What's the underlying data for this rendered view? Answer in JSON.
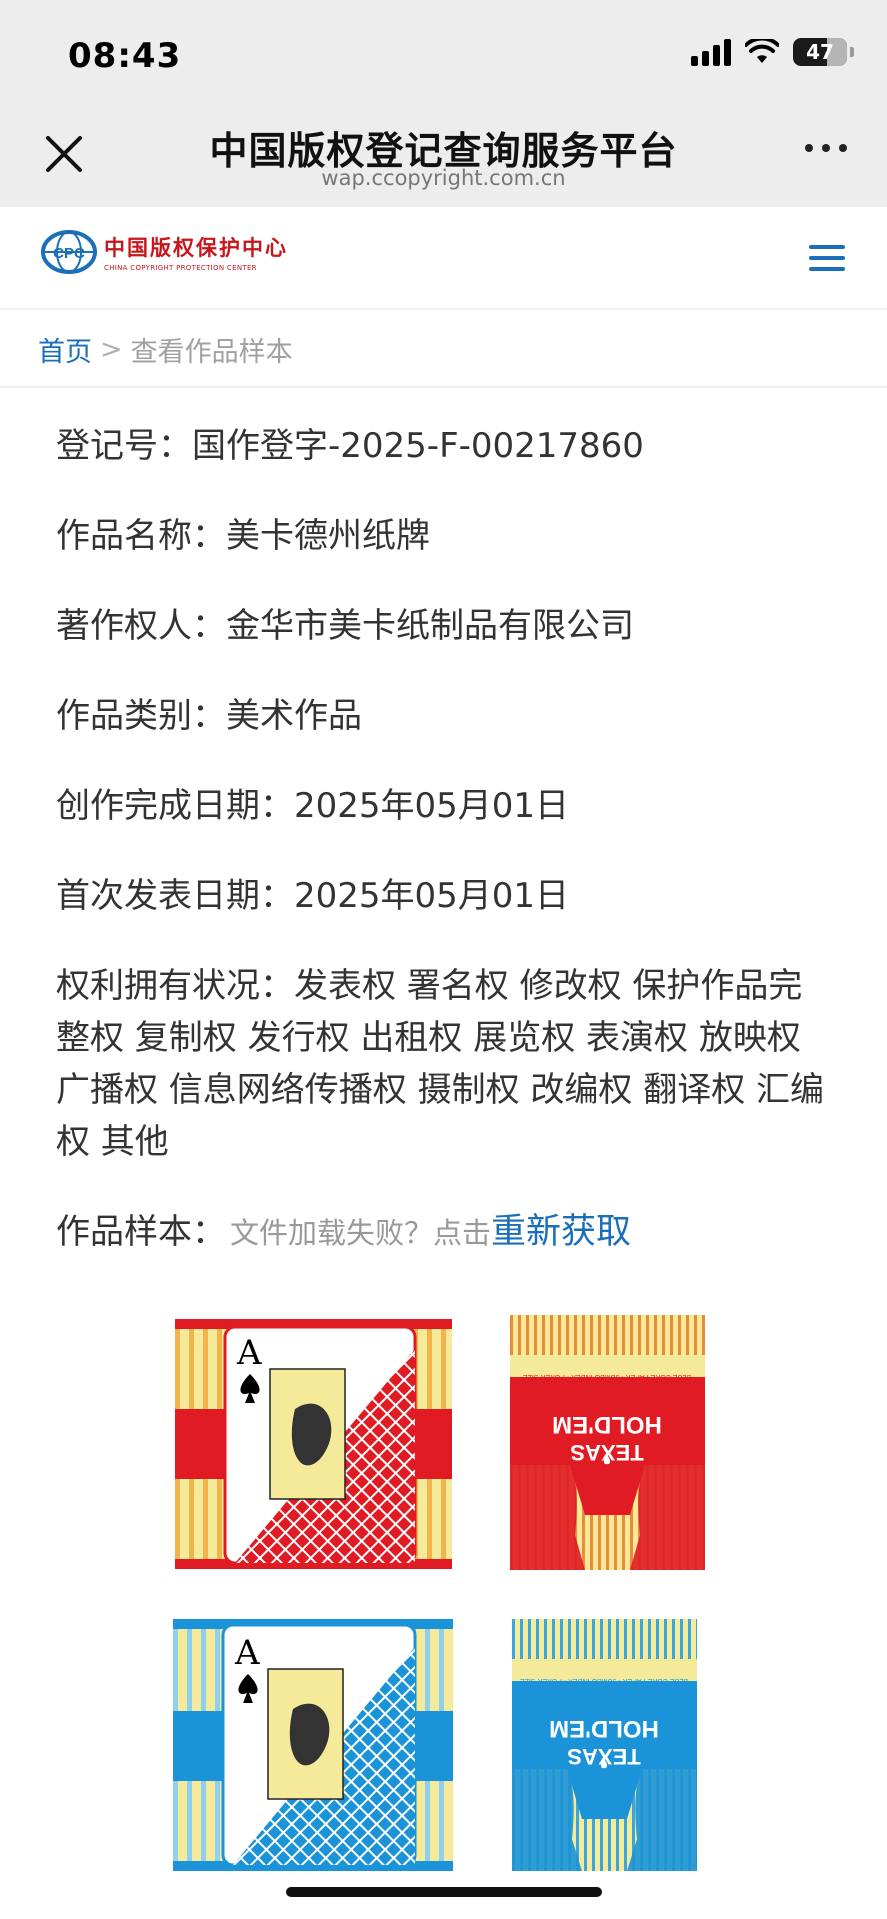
{
  "status_bar": {
    "time": "08:43",
    "battery": "47"
  },
  "nav": {
    "title": "中国版权登记查询服务平台",
    "url": "wap.ccopyright.com.cn"
  },
  "site": {
    "logo_cn": "中国版权保护中心",
    "logo_en": "CHINA COPYRIGHT PROTECTION CENTER",
    "logo_mark": "CPC"
  },
  "breadcrumb": {
    "home": "首页",
    "separator": ">",
    "current": "查看作品样本"
  },
  "record": {
    "reg_label": "登记号：",
    "reg_value": "国作登字-2025-F-00217860",
    "name_label": "作品名称：",
    "name_value": "美卡德州纸牌",
    "owner_label": "著作权人：",
    "owner_value": "金华市美卡纸制品有限公司",
    "category_label": "作品类别：",
    "category_value": "美术作品",
    "created_label": "创作完成日期：",
    "created_value": "2025年05月01日",
    "published_label": "首次发表日期：",
    "published_value": "2025年05月01日",
    "rights_label": "权利拥有状况：",
    "rights_value": "发表权 署名权 修改权 保护作品完整权 复制权 发行权 出租权 展览权 表演权 放映权 广播权 信息网络传播权 摄制权 改编权 翻译权 汇编权 其他",
    "sample_label": "作品样本：",
    "sample_hint": "文件加载失败？点击",
    "sample_retry": "重新获取"
  },
  "cards": {
    "rank": "A",
    "box_brand_line1": "TEXAS",
    "box_brand_line2": "HOLD'EM",
    "box_small_line": "BLUE CORE PAPER • JUMBO INDEX • POKER SIZE"
  },
  "colors": {
    "accent": "#1a6fb8",
    "red_card": "#e01b24",
    "blue_card": "#1b93d8",
    "cream": "#f5ea9a"
  }
}
